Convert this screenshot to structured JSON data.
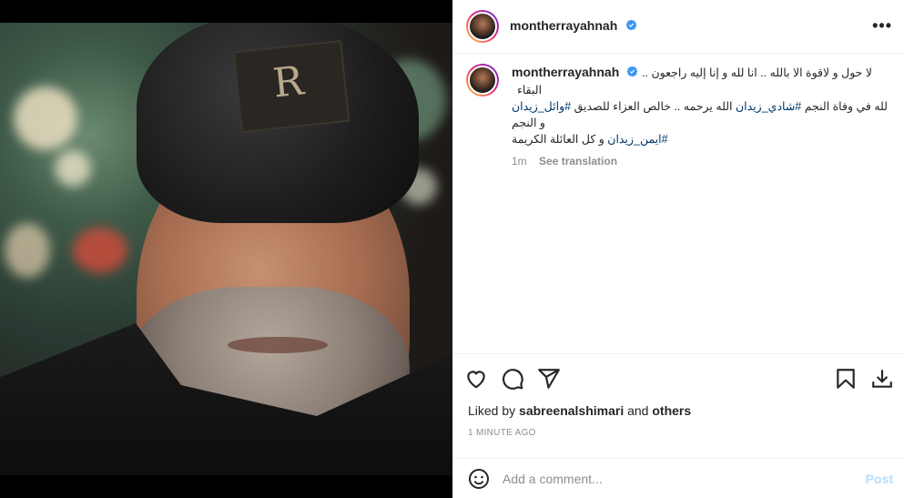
{
  "post": {
    "username": "montherrayahnah",
    "verified": true,
    "caption": {
      "username": "montherrayahnah",
      "line1": "لا حول و لاقوة الا بالله .. انا لله و إنا إليه راجعون .. البقاء",
      "line2_prefix": "لله في وفاة النجم ",
      "line2_tag1": "#شادي_زيدان",
      "line2_mid": " الله يرحمه .. خالص العزاء للصديق ",
      "line2_tag2": "#وائل_زيدان",
      "line2_suffix": " و النجم",
      "line3_tag": "#ايمن_زيدان",
      "line3_suffix": " و كل العائلة الكريمة",
      "age": "1m",
      "see_translation": "See translation"
    },
    "likes": {
      "prefix": "Liked by",
      "user": "sabreenalshimari",
      "middle": "and",
      "others": "others"
    },
    "timestamp": "1 MINUTE AGO",
    "comment": {
      "placeholder": "Add a comment...",
      "post_label": "Post"
    }
  },
  "icons": {
    "like": "heart-icon",
    "comment": "comment-icon",
    "share": "share-icon",
    "save": "bookmark-icon",
    "download": "download-icon",
    "emoji": "emoji-icon",
    "more": "more-options-icon"
  },
  "colors": {
    "verified": "#3897f0",
    "hashtag": "#00376b",
    "post_disabled": "#b2dffc",
    "muted": "#8e8e8e"
  }
}
